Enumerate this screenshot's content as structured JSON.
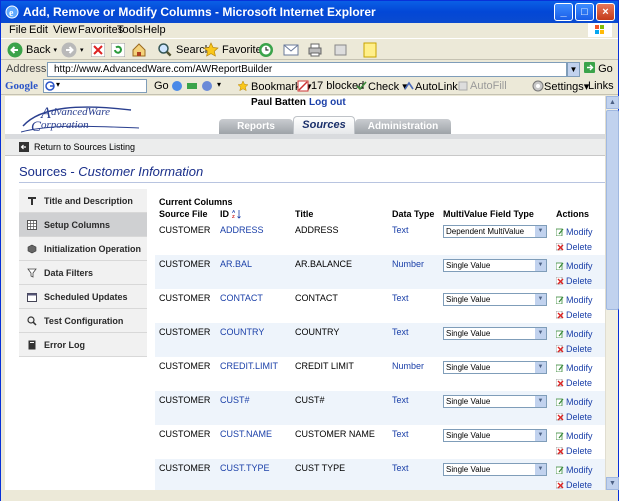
{
  "window": {
    "title": "Add, Remove or Modify Columns - Microsoft Internet Explorer",
    "buttons": {
      "minimize": "_",
      "maximize": "□",
      "close": "×"
    }
  },
  "menu": [
    "File",
    "Edit",
    "View",
    "Favorites",
    "Tools",
    "Help"
  ],
  "toolbar": {
    "back": "Back",
    "search": "Search",
    "favorites": "Favorites"
  },
  "address": {
    "label": "Address",
    "url": "http://www.AdvancedWare.com/AWReportBuilder",
    "go": "Go"
  },
  "googlebar": {
    "brand": "Google",
    "go": "Go",
    "bookmarks": "Bookmarks▾",
    "blocked": "17 blocked",
    "check": "Check ▾",
    "autolink": "AutoLink ▾",
    "autofill": "AutoFill",
    "settings": "Settings▾",
    "links": "Links"
  },
  "page": {
    "logo": {
      "line1": "dvancedWare",
      "line2": "orporation"
    },
    "user": "Paul Batten",
    "logout": "Log out",
    "tabs": [
      "Reports",
      "Sources",
      "Administration"
    ],
    "return_link": "Return to Sources Listing",
    "title_main": "Sources",
    "title_sep": " - ",
    "title_sub": "Customer Information",
    "nav": [
      "Title and Description",
      "Setup Columns",
      "Initialization Operation",
      "Data Filters",
      "Scheduled Updates",
      "Test Configuration",
      "Error Log"
    ],
    "current_columns": "Current Columns",
    "headers": [
      "Source File",
      "ID",
      "Title",
      "Data Type",
      "MultiValue Field Type",
      "Actions"
    ],
    "modify": "Modify",
    "delete": "Delete",
    "rows": [
      {
        "source": "CUSTOMER",
        "id": "ADDRESS",
        "title": "ADDRESS",
        "type": "Text",
        "mv": "Dependent MultiValue"
      },
      {
        "source": "CUSTOMER",
        "id": "AR.BAL",
        "title": "AR.BALANCE",
        "type": "Number",
        "mv": "Single Value"
      },
      {
        "source": "CUSTOMER",
        "id": "CONTACT",
        "title": "CONTACT",
        "type": "Text",
        "mv": "Single Value"
      },
      {
        "source": "CUSTOMER",
        "id": "COUNTRY",
        "title": "COUNTRY",
        "type": "Text",
        "mv": "Single Value"
      },
      {
        "source": "CUSTOMER",
        "id": "CREDIT.LIMIT",
        "title": "CREDIT LIMIT",
        "type": "Number",
        "mv": "Single Value"
      },
      {
        "source": "CUSTOMER",
        "id": "CUST#",
        "title": "CUST#",
        "type": "Text",
        "mv": "Single Value"
      },
      {
        "source": "CUSTOMER",
        "id": "CUST.NAME",
        "title": "CUSTOMER NAME",
        "type": "Text",
        "mv": "Single Value"
      },
      {
        "source": "CUSTOMER",
        "id": "CUST.TYPE",
        "title": "CUST TYPE",
        "type": "Text",
        "mv": "Single Value"
      }
    ]
  }
}
